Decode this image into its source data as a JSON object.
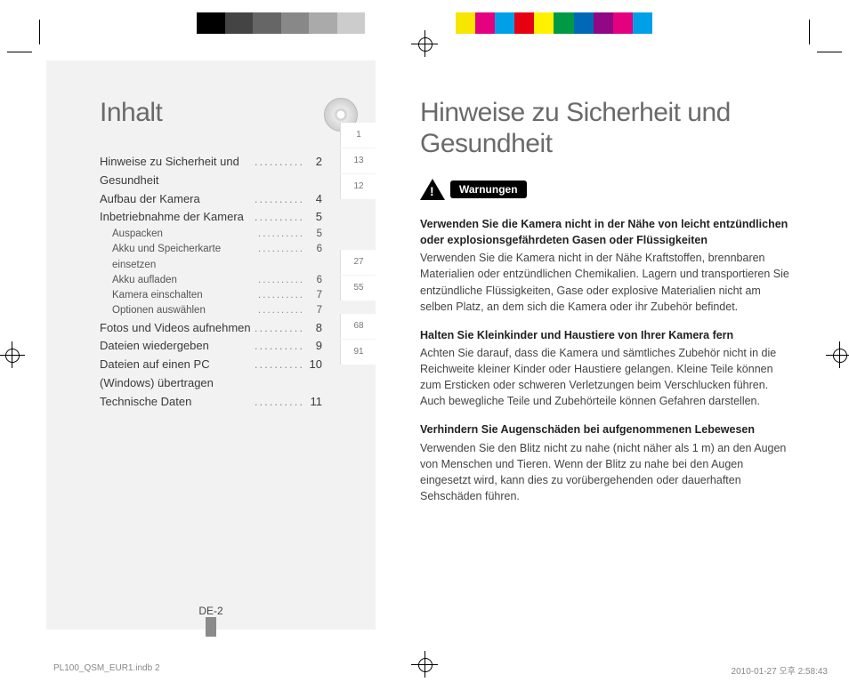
{
  "colorbar_colors_left": [
    "#000",
    "#444",
    "#666",
    "#888",
    "#aaa",
    "#ccc",
    "#fff"
  ],
  "colorbar_colors_right": [
    "#f7e600",
    "#e4007f",
    "#00a0e9",
    "#e60012",
    "#fff100",
    "#009944",
    "#0068b7",
    "#920783",
    "#e4007f",
    "#00a0e9"
  ],
  "left": {
    "title": "Inhalt",
    "toc_main": [
      {
        "label": "Hinweise zu Sicherheit und Gesundheit",
        "page": "2"
      },
      {
        "label": "Aufbau der Kamera",
        "page": "4"
      },
      {
        "label": "Inbetriebnahme der Kamera",
        "page": "5"
      }
    ],
    "toc_sub": [
      {
        "label": "Auspacken",
        "page": "5"
      },
      {
        "label": "Akku und Speicherkarte einsetzen",
        "page": "6"
      },
      {
        "label": "Akku aufladen",
        "page": "6"
      },
      {
        "label": "Kamera einschalten",
        "page": "7"
      },
      {
        "label": "Optionen auswählen",
        "page": "7"
      }
    ],
    "toc_tail": [
      {
        "label": "Fotos und Videos aufnehmen",
        "page": "8"
      },
      {
        "label": "Dateien wiedergeben",
        "page": "9"
      },
      {
        "label": "Dateien auf einen PC (Windows) übertragen",
        "page": "10"
      },
      {
        "label": "Technische Daten",
        "page": "11"
      }
    ],
    "tabs": [
      "1",
      "13",
      "12",
      "",
      "",
      "",
      "",
      "27",
      "55",
      "",
      "68",
      "91"
    ],
    "pagecode": "DE-2"
  },
  "right": {
    "title": "Hinweise zu Sicherheit und Gesundheit",
    "warn_label": "Warnungen",
    "para1_bold": "Verwenden Sie die Kamera nicht in der Nähe von leicht entzündlichen oder explosionsgefährdeten Gasen oder Flüssigkeiten",
    "para1_body": "Verwenden Sie die Kamera nicht in der Nähe Kraftstoffen, brennbaren Materialien oder entzündlichen Chemikalien. Lagern und transportieren Sie entzündliche Flüssigkeiten, Gase oder explosive Materialien nicht am selben Platz, an dem sich die Kamera oder ihr Zubehör befindet.",
    "para2_bold": "Halten Sie Kleinkinder und Haustiere von Ihrer Kamera fern",
    "para2_body": "Achten Sie darauf, dass die Kamera und sämtliches Zubehör nicht in die Reichweite kleiner Kinder oder Haustiere gelangen. Kleine Teile können zum Ersticken oder schweren Verletzungen beim Verschlucken führen. Auch bewegliche Teile und Zubehörteile können Gefahren darstellen.",
    "para3_bold": "Verhindern Sie Augenschäden bei aufgenommenen Lebewesen",
    "para3_body": "Verwenden Sie den Blitz nicht zu nahe (nicht näher als 1 m) an den Augen von Menschen und Tieren. Wenn der Blitz zu nahe bei den Augen eingesetzt wird, kann dies zu vorübergehenden oder dauerhaften Sehschäden führen."
  },
  "footer_left": "PL100_QSM_EUR1.indb   2",
  "footer_right": "2010-01-27   오후 2:58:43"
}
